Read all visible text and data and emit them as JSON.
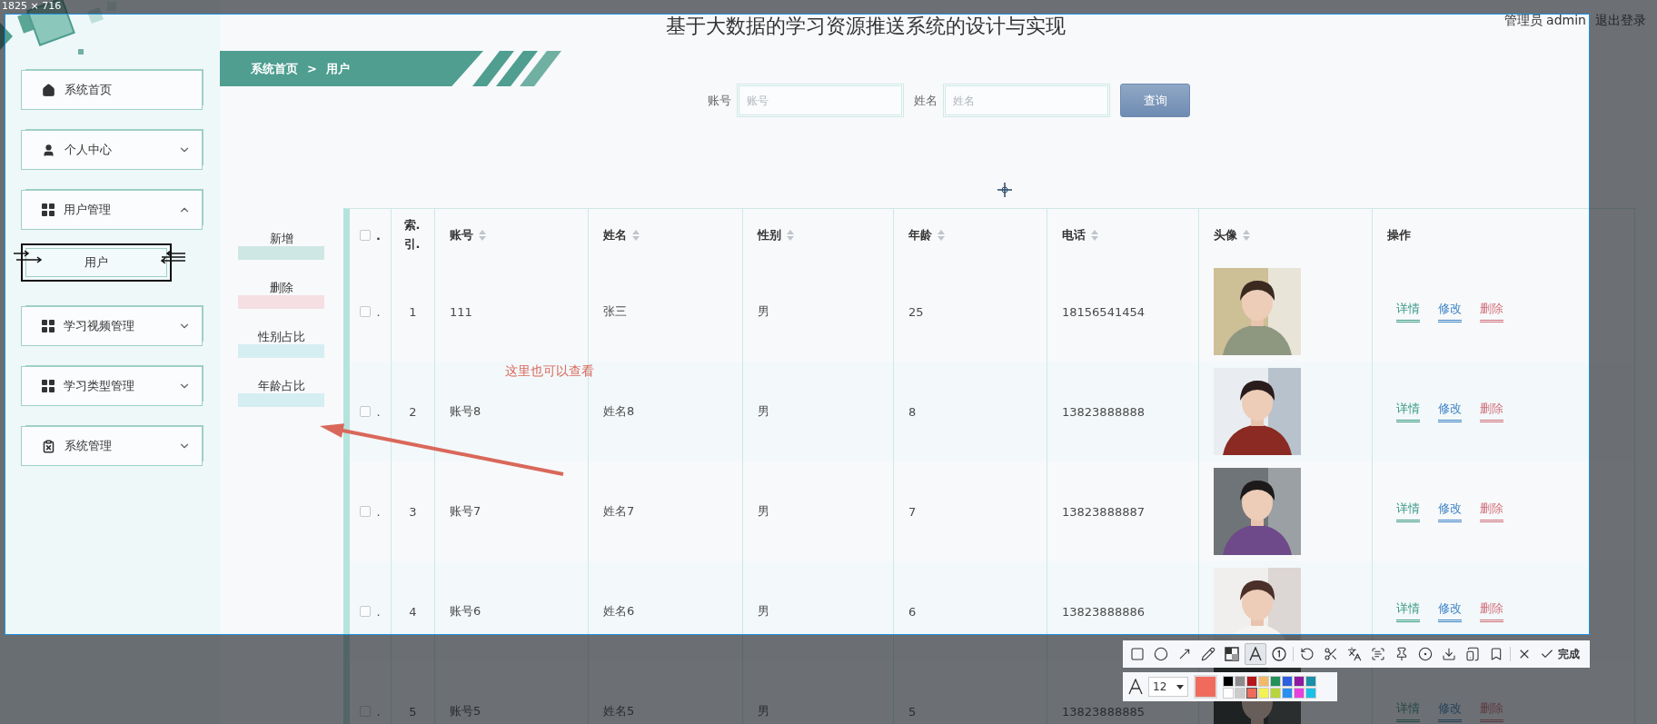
{
  "capture": {
    "size_label": "1825 × 716",
    "annotation": {
      "text": "这里也可以查看"
    },
    "toolbar": {
      "groups": [
        {
          "tools": [
            {
              "kind": "rectangle",
              "selected": false
            },
            {
              "kind": "ellipse",
              "selected": false
            },
            {
              "kind": "arrow",
              "selected": false
            },
            {
              "kind": "pencil",
              "selected": false
            },
            {
              "kind": "mosaic",
              "selected": false
            },
            {
              "kind": "text",
              "selected": true
            },
            {
              "kind": "number",
              "selected": false
            }
          ]
        },
        {
          "tools": [
            {
              "kind": "undo",
              "selected": false
            },
            {
              "kind": "cut",
              "selected": false
            },
            {
              "kind": "translate",
              "selected": false
            },
            {
              "kind": "scan",
              "selected": false
            },
            {
              "kind": "pin",
              "selected": false
            },
            {
              "kind": "record",
              "selected": false
            },
            {
              "kind": "download",
              "selected": false
            },
            {
              "kind": "phone",
              "selected": false
            },
            {
              "kind": "bookmark",
              "selected": false
            }
          ]
        },
        {
          "tools": [
            {
              "kind": "close",
              "selected": false
            },
            {
              "kind": "done",
              "selected": false,
              "label": "完成"
            }
          ]
        }
      ]
    },
    "text_settings": {
      "font_size": "12",
      "palette": [
        {
          "color": "#000000",
          "selected": false
        },
        {
          "color": "#8c8c8c",
          "selected": false
        },
        {
          "color": "#b5171d",
          "selected": false
        },
        {
          "color": "#f2b96b",
          "selected": false
        },
        {
          "color": "#23915a",
          "selected": false
        },
        {
          "color": "#2d5fe0",
          "selected": false
        },
        {
          "color": "#8e1aa0",
          "selected": false
        },
        {
          "color": "#1a8fa8",
          "selected": false
        },
        {
          "color": "#ffffff",
          "selected": false
        },
        {
          "color": "#cccccc",
          "selected": false
        },
        {
          "color": "#ef6b5c",
          "selected": true
        },
        {
          "color": "#f4f251",
          "selected": false
        },
        {
          "color": "#b7d53a",
          "selected": false
        },
        {
          "color": "#2a8ff0",
          "selected": false
        },
        {
          "color": "#e640e0",
          "selected": false
        },
        {
          "color": "#1bc0e8",
          "selected": false
        }
      ]
    }
  },
  "app": {
    "title": "基于大数据的学习资源推送系统的设计与实现",
    "user": {
      "label": "管理员 admin",
      "logout": "退出登录"
    },
    "sidebar": {
      "items": [
        {
          "label": "系统首页",
          "kind": "home"
        },
        {
          "label": "个人中心",
          "kind": "person",
          "expanded": false
        },
        {
          "label": "用户管理",
          "kind": "grid",
          "expanded": true,
          "children": [
            {
              "label": "用户",
              "selected": true
            }
          ]
        },
        {
          "label": "学习视频管理",
          "kind": "grid",
          "expanded": false
        },
        {
          "label": "学习类型管理",
          "kind": "grid",
          "expanded": false
        },
        {
          "label": "系统管理",
          "kind": "clipboard",
          "expanded": false
        }
      ]
    },
    "breadcrumb": {
      "items": [
        "系统首页",
        "用户"
      ],
      "separator": ">"
    },
    "search": {
      "fields": [
        {
          "label": "账号",
          "placeholder": "账号"
        },
        {
          "label": "姓名",
          "placeholder": "姓名"
        }
      ],
      "button": "查询"
    },
    "actions": [
      {
        "label": "新增",
        "color": "#cfe7e4"
      },
      {
        "label": "删除",
        "color": "#f6dfe2"
      },
      {
        "label": "性别占比",
        "color": "#d5eef2"
      },
      {
        "label": "年龄占比",
        "color": "#d5eef2"
      }
    ],
    "table": {
      "columns": [
        {
          "kind": "select",
          "label": ".",
          "checked": false
        },
        {
          "kind": "index",
          "label": "索.引."
        },
        {
          "kind": "text",
          "label": "账号",
          "sortable": true
        },
        {
          "kind": "text",
          "label": "姓名",
          "sortable": true
        },
        {
          "kind": "text",
          "label": "性别",
          "sortable": true
        },
        {
          "kind": "text",
          "label": "年龄",
          "sortable": true
        },
        {
          "kind": "text",
          "label": "电话",
          "sortable": true
        },
        {
          "kind": "avatar",
          "label": "头像",
          "sortable": true
        },
        {
          "kind": "actions",
          "label": "操作",
          "sortable": false
        }
      ],
      "rows": [
        {
          "checked": false,
          "mark": ".",
          "index": "1",
          "account": "111",
          "name": "张三",
          "gender": "男",
          "age": "25",
          "phone": "18156541454",
          "actions": [
            {
              "label": "详情",
              "kind": "detail"
            },
            {
              "label": "修改",
              "kind": "edit"
            },
            {
              "label": "删除",
              "kind": "delete"
            }
          ]
        },
        {
          "checked": false,
          "mark": ".",
          "index": "2",
          "account": "账号8",
          "name": "姓名8",
          "gender": "男",
          "age": "8",
          "phone": "13823888888",
          "actions": [
            {
              "label": "详情",
              "kind": "detail"
            },
            {
              "label": "修改",
              "kind": "edit"
            },
            {
              "label": "删除",
              "kind": "delete"
            }
          ]
        },
        {
          "checked": false,
          "mark": ".",
          "index": "3",
          "account": "账号7",
          "name": "姓名7",
          "gender": "男",
          "age": "7",
          "phone": "13823888887",
          "actions": [
            {
              "label": "详情",
              "kind": "detail"
            },
            {
              "label": "修改",
              "kind": "edit"
            },
            {
              "label": "删除",
              "kind": "delete"
            }
          ]
        },
        {
          "checked": false,
          "mark": ".",
          "index": "4",
          "account": "账号6",
          "name": "姓名6",
          "gender": "男",
          "age": "6",
          "phone": "13823888886",
          "actions": [
            {
              "label": "详情",
              "kind": "detail"
            },
            {
              "label": "修改",
              "kind": "edit"
            },
            {
              "label": "删除",
              "kind": "delete"
            }
          ]
        },
        {
          "checked": false,
          "mark": ".",
          "index": "5",
          "account": "账号5",
          "name": "姓名5",
          "gender": "男",
          "age": "5",
          "phone": "13823888885",
          "actions": [
            {
              "label": "详情",
              "kind": "detail"
            },
            {
              "label": "修改",
              "kind": "edit"
            },
            {
              "label": "删除",
              "kind": "delete"
            }
          ]
        }
      ]
    }
  }
}
